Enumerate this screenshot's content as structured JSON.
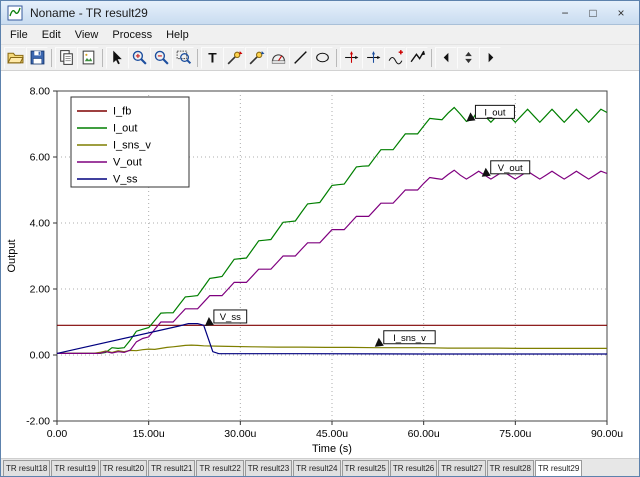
{
  "window": {
    "title": "Noname - TR result29",
    "controls": {
      "minimize": "−",
      "maximize": "□",
      "close": "×"
    }
  },
  "menu": {
    "items": [
      "File",
      "Edit",
      "View",
      "Process",
      "Help"
    ]
  },
  "toolbar": {
    "icons": [
      "open",
      "save",
      "copy",
      "copy-image",
      "select-arrow",
      "zoom-in",
      "zoom-out",
      "zoom-area",
      "text",
      "probe-voltage",
      "probe-current",
      "meter",
      "line",
      "ellipse",
      "axis-x",
      "axis-y",
      "add-curve",
      "curve-marker",
      "scroll-left",
      "spinner",
      "scroll-right"
    ]
  },
  "chart_data": {
    "type": "line",
    "title": "",
    "xlabel": "Time (s)",
    "ylabel": "Output",
    "xlim": [
      0,
      90
    ],
    "ylim": [
      -2,
      8
    ],
    "x_unit": "u",
    "grid": "dotted",
    "legend_position": "top-left",
    "xticks": [
      {
        "v": 0,
        "label": "0.00"
      },
      {
        "v": 15,
        "label": "15.00u"
      },
      {
        "v": 30,
        "label": "30.00u"
      },
      {
        "v": 45,
        "label": "45.00u"
      },
      {
        "v": 60,
        "label": "60.00u"
      },
      {
        "v": 75,
        "label": "75.00u"
      },
      {
        "v": 90,
        "label": "90.00u"
      }
    ],
    "yticks": [
      {
        "v": -2,
        "label": "-2.00"
      },
      {
        "v": 0,
        "label": "0.00"
      },
      {
        "v": 2,
        "label": "2.00"
      },
      {
        "v": 4,
        "label": "4.00"
      },
      {
        "v": 6,
        "label": "6.00"
      },
      {
        "v": 8,
        "label": "8.00"
      }
    ],
    "series": [
      {
        "name": "I_fb",
        "color": "#7f0000",
        "points": [
          [
            0,
            0.9
          ],
          [
            90,
            0.9
          ]
        ]
      },
      {
        "name": "I_out",
        "color": "#007f00",
        "points": [
          [
            0,
            0.05
          ],
          [
            7,
            0.05
          ],
          [
            8,
            0.08
          ],
          [
            9,
            0.22
          ],
          [
            10,
            0.2
          ],
          [
            11,
            0.22
          ],
          [
            12,
            0.45
          ],
          [
            13,
            0.72
          ],
          [
            14,
            0.78
          ],
          [
            15,
            0.83
          ],
          [
            16,
            1.05
          ],
          [
            17,
            1.27
          ],
          [
            18,
            1.28
          ],
          [
            19,
            1.28
          ],
          [
            20,
            1.52
          ],
          [
            21,
            1.76
          ],
          [
            22,
            1.78
          ],
          [
            23,
            1.8
          ],
          [
            24,
            2.06
          ],
          [
            25,
            2.32
          ],
          [
            26,
            2.35
          ],
          [
            27,
            2.38
          ],
          [
            28,
            2.64
          ],
          [
            29,
            2.9
          ],
          [
            30,
            2.92
          ],
          [
            31,
            2.94
          ],
          [
            32,
            3.2
          ],
          [
            33,
            3.46
          ],
          [
            34,
            3.48
          ],
          [
            35,
            3.5
          ],
          [
            36,
            3.76
          ],
          [
            37,
            4.02
          ],
          [
            38,
            4.04
          ],
          [
            39,
            4.06
          ],
          [
            40,
            4.32
          ],
          [
            41,
            4.58
          ],
          [
            42,
            4.6
          ],
          [
            43,
            4.62
          ],
          [
            44,
            4.88
          ],
          [
            45,
            5.14
          ],
          [
            46,
            5.16
          ],
          [
            47,
            5.18
          ],
          [
            48,
            5.44
          ],
          [
            49,
            5.7
          ],
          [
            50,
            5.72
          ],
          [
            51,
            5.73
          ],
          [
            52,
            5.98
          ],
          [
            53,
            6.22
          ],
          [
            54,
            6.22
          ],
          [
            55,
            6.22
          ],
          [
            56,
            6.46
          ],
          [
            57,
            6.7
          ],
          [
            58,
            6.7
          ],
          [
            59,
            6.7
          ],
          [
            60,
            6.94
          ],
          [
            61,
            7.17
          ],
          [
            62,
            7.15
          ],
          [
            63,
            7.13
          ],
          [
            64,
            7.33
          ],
          [
            65,
            7.5
          ],
          [
            66,
            7.3
          ],
          [
            67,
            7.08
          ],
          [
            68,
            7.15
          ],
          [
            69,
            7.45
          ],
          [
            70,
            7.25
          ],
          [
            71,
            7.05
          ],
          [
            72,
            7.25
          ],
          [
            73,
            7.45
          ],
          [
            74,
            7.25
          ],
          [
            75,
            7.05
          ],
          [
            76,
            7.25
          ],
          [
            77,
            7.45
          ],
          [
            78,
            7.25
          ],
          [
            79,
            7.05
          ],
          [
            80,
            7.25
          ],
          [
            81,
            7.45
          ],
          [
            82,
            7.25
          ],
          [
            83,
            7.05
          ],
          [
            84,
            7.25
          ],
          [
            85,
            7.45
          ],
          [
            86,
            7.25
          ],
          [
            87,
            7.05
          ],
          [
            88,
            7.25
          ],
          [
            89,
            7.45
          ],
          [
            90,
            7.35
          ]
        ]
      },
      {
        "name": "I_sns_v",
        "color": "#7f7f00",
        "points": [
          [
            0,
            0.05
          ],
          [
            6,
            0.05
          ],
          [
            7,
            0.08
          ],
          [
            8,
            0.12
          ],
          [
            9,
            0.08
          ],
          [
            10,
            0.13
          ],
          [
            11,
            0.1
          ],
          [
            12,
            0.14
          ],
          [
            13,
            0.13
          ],
          [
            14,
            0.16
          ],
          [
            15,
            0.18
          ],
          [
            16,
            0.17
          ],
          [
            17,
            0.2
          ],
          [
            18,
            0.23
          ],
          [
            19,
            0.25
          ],
          [
            20,
            0.27
          ],
          [
            21,
            0.29
          ],
          [
            22,
            0.3
          ],
          [
            23,
            0.29
          ],
          [
            24,
            0.28
          ],
          [
            26,
            0.27
          ],
          [
            28,
            0.26
          ],
          [
            32,
            0.25
          ],
          [
            36,
            0.24
          ],
          [
            40,
            0.24
          ],
          [
            44,
            0.23
          ],
          [
            48,
            0.23
          ],
          [
            52,
            0.22
          ],
          [
            56,
            0.22
          ],
          [
            60,
            0.22
          ],
          [
            64,
            0.21
          ],
          [
            68,
            0.21
          ],
          [
            72,
            0.21
          ],
          [
            76,
            0.2
          ],
          [
            80,
            0.2
          ],
          [
            85,
            0.2
          ],
          [
            90,
            0.2
          ]
        ]
      },
      {
        "name": "V_out",
        "color": "#7f007f",
        "points": [
          [
            0,
            0.05
          ],
          [
            7,
            0.05
          ],
          [
            8,
            0.1
          ],
          [
            9,
            0.06
          ],
          [
            10,
            0.1
          ],
          [
            11,
            0.08
          ],
          [
            12,
            0.15
          ],
          [
            13,
            0.4
          ],
          [
            14,
            0.5
          ],
          [
            15,
            0.55
          ],
          [
            16,
            0.78
          ],
          [
            17,
            1.0
          ],
          [
            18,
            1.0
          ],
          [
            19,
            1.0
          ],
          [
            20,
            1.2
          ],
          [
            21,
            1.4
          ],
          [
            22,
            1.4
          ],
          [
            23,
            1.4
          ],
          [
            24,
            1.6
          ],
          [
            25,
            1.8
          ],
          [
            26,
            1.8
          ],
          [
            27,
            1.8
          ],
          [
            28,
            2.0
          ],
          [
            29,
            2.2
          ],
          [
            30,
            2.2
          ],
          [
            31,
            2.2
          ],
          [
            32,
            2.4
          ],
          [
            33,
            2.6
          ],
          [
            34,
            2.6
          ],
          [
            35,
            2.6
          ],
          [
            36,
            2.8
          ],
          [
            37,
            3.0
          ],
          [
            38,
            3.0
          ],
          [
            39,
            3.0
          ],
          [
            40,
            3.2
          ],
          [
            41,
            3.4
          ],
          [
            42,
            3.4
          ],
          [
            43,
            3.4
          ],
          [
            44,
            3.6
          ],
          [
            45,
            3.8
          ],
          [
            46,
            3.8
          ],
          [
            47,
            3.8
          ],
          [
            48,
            4.0
          ],
          [
            49,
            4.2
          ],
          [
            50,
            4.2
          ],
          [
            51,
            4.2
          ],
          [
            52,
            4.4
          ],
          [
            53,
            4.6
          ],
          [
            54,
            4.6
          ],
          [
            55,
            4.6
          ],
          [
            56,
            4.8
          ],
          [
            57,
            5.0
          ],
          [
            58,
            5.0
          ],
          [
            59,
            5.0
          ],
          [
            60,
            5.2
          ],
          [
            61,
            5.38
          ],
          [
            62,
            5.35
          ],
          [
            63,
            5.32
          ],
          [
            64,
            5.47
          ],
          [
            65,
            5.6
          ],
          [
            66,
            5.45
          ],
          [
            67,
            5.33
          ],
          [
            68,
            5.45
          ],
          [
            69,
            5.57
          ],
          [
            70,
            5.45
          ],
          [
            71,
            5.33
          ],
          [
            72,
            5.45
          ],
          [
            73,
            5.57
          ],
          [
            74,
            5.45
          ],
          [
            75,
            5.33
          ],
          [
            76,
            5.45
          ],
          [
            77,
            5.57
          ],
          [
            78,
            5.45
          ],
          [
            79,
            5.33
          ],
          [
            80,
            5.45
          ],
          [
            81,
            5.57
          ],
          [
            82,
            5.45
          ],
          [
            83,
            5.33
          ],
          [
            84,
            5.45
          ],
          [
            85,
            5.57
          ],
          [
            86,
            5.45
          ],
          [
            87,
            5.33
          ],
          [
            88,
            5.45
          ],
          [
            89,
            5.57
          ],
          [
            90,
            5.5
          ]
        ]
      },
      {
        "name": "V_ss",
        "color": "#00007f",
        "points": [
          [
            0,
            0.05
          ],
          [
            20,
            0.88
          ],
          [
            21.5,
            0.95
          ],
          [
            23,
            0.95
          ],
          [
            24,
            0.9
          ],
          [
            25.5,
            0.1
          ],
          [
            26.5,
            0.04
          ],
          [
            40,
            0.04
          ],
          [
            60,
            0.03
          ],
          [
            90,
            0.03
          ]
        ]
      }
    ],
    "annotations": [
      {
        "label": "I_out",
        "t": 67,
        "v": 7.08
      },
      {
        "label": "V_out",
        "t": 69.5,
        "v": 5.4
      },
      {
        "label": "V_ss",
        "t": 24.2,
        "v": 0.88
      },
      {
        "label": "I_sns_v",
        "t": 52,
        "v": 0.25
      }
    ]
  },
  "tabs": {
    "items": [
      "TR result18",
      "TR result19",
      "TR result20",
      "TR result21",
      "TR result22",
      "TR result23",
      "TR result24",
      "TR result25",
      "TR result26",
      "TR result27",
      "TR result28",
      "TR result29"
    ],
    "active": "TR result29"
  }
}
